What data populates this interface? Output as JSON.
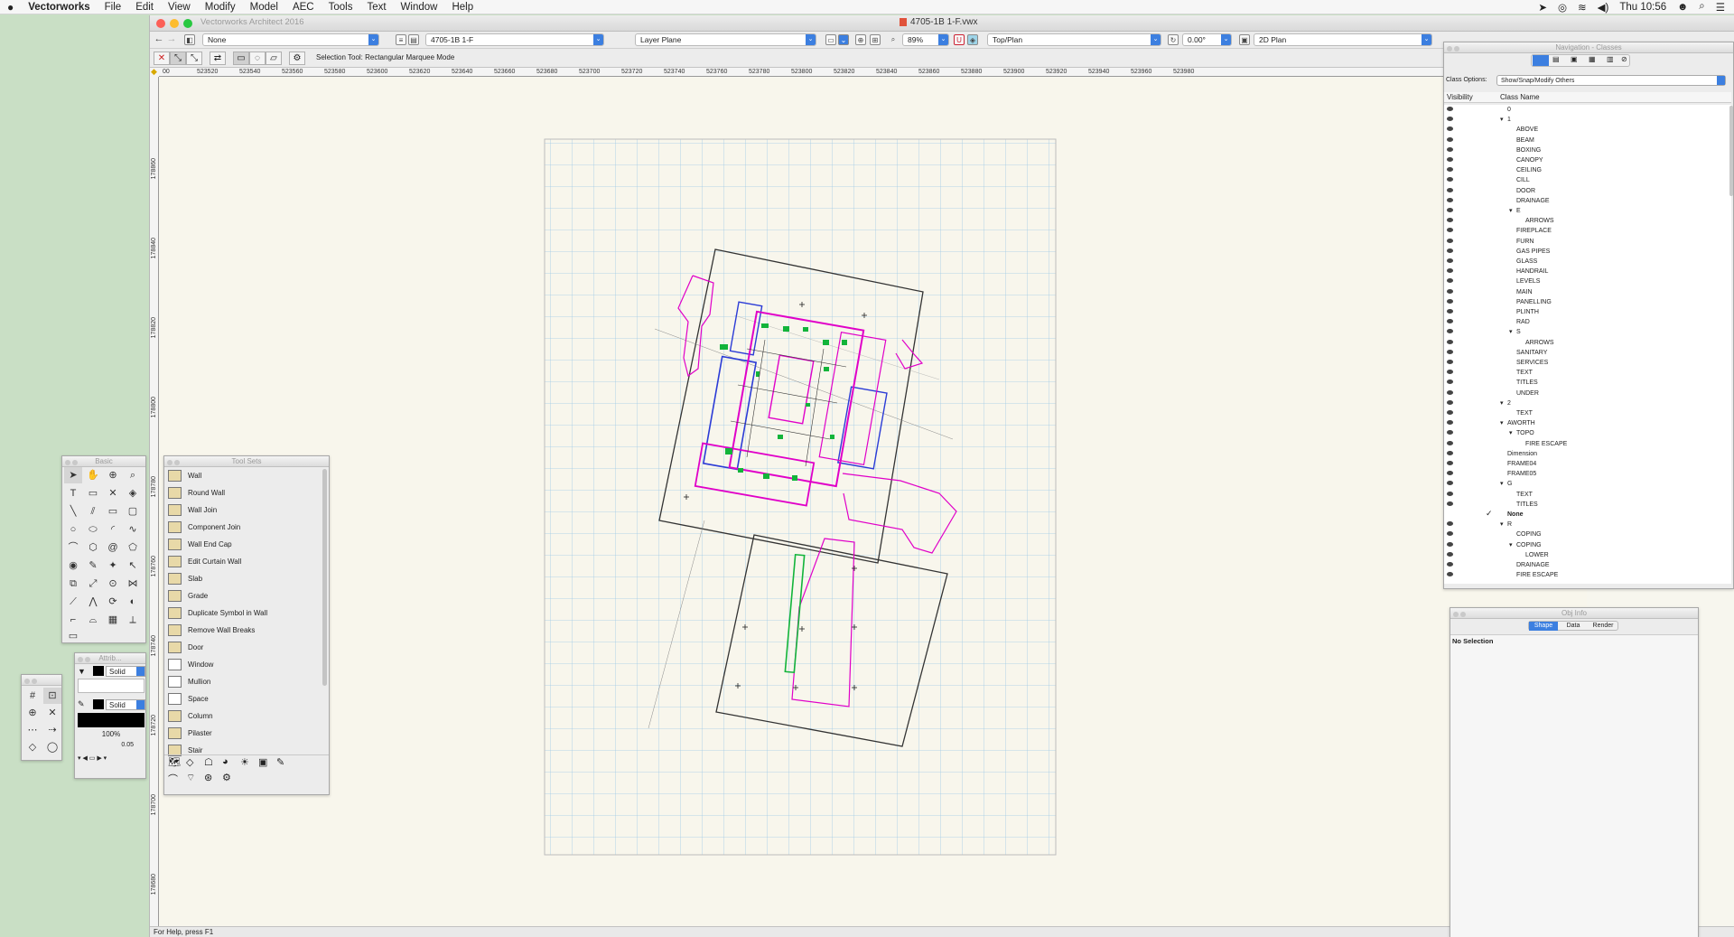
{
  "menubar": {
    "apple": "",
    "app": "Vectorworks",
    "items": [
      "File",
      "Edit",
      "View",
      "Modify",
      "Model",
      "AEC",
      "Tools",
      "Text",
      "Window",
      "Help"
    ],
    "clock": "Thu 10:56"
  },
  "window": {
    "app_title": "Vectorworks Architect 2016",
    "doc_title": "4705-1B 1-F.vwx"
  },
  "toolbar": {
    "class_dropdown": "None",
    "layer_dropdown": "4705-1B 1-F",
    "plane_dropdown": "Layer Plane",
    "zoom": "89%",
    "view": "Top/Plan",
    "rotation": "0.00°",
    "render": "2D Plan",
    "mode_hint": "Selection Tool: Rectangular Marquee Mode"
  },
  "ruler": {
    "top_ticks": [
      "00",
      "523520",
      "523540",
      "523560",
      "523580",
      "523600",
      "523620",
      "523640",
      "523660",
      "523680",
      "523700",
      "523720",
      "523740",
      "523760",
      "523780",
      "523800",
      "523820",
      "523840",
      "523860",
      "523880",
      "523900",
      "523920",
      "523940",
      "523960",
      "523980"
    ],
    "left_ticks": [
      "178860",
      "178840",
      "178820",
      "178800",
      "178780",
      "178760",
      "178740",
      "178720",
      "178700",
      "178680"
    ]
  },
  "basic_palette": {
    "title": "Basic"
  },
  "attrib_palette": {
    "title": "Attrib...",
    "fill": "Solid",
    "pen": "Solid",
    "opacity": "100%",
    "lineweight": "0.05"
  },
  "toolsets_palette": {
    "title": "Tool Sets",
    "items": [
      "Wall",
      "Round Wall",
      "Wall Join",
      "Component Join",
      "Wall End Cap",
      "Edit Curtain Wall",
      "Slab",
      "Grade",
      "Duplicate Symbol in Wall",
      "Remove Wall Breaks",
      "Door",
      "Window",
      "Mullion",
      "Space",
      "Column",
      "Pilaster",
      "Stair"
    ]
  },
  "navigation": {
    "title": "Navigation - Classes",
    "class_options_label": "Class Options:",
    "class_options_value": "Show/Snap/Modify Others",
    "col_visibility": "Visibility",
    "col_class": "Class Name",
    "classes": [
      {
        "name": "0",
        "indent": 0,
        "tri": false
      },
      {
        "name": "1",
        "indent": 0,
        "tri": true
      },
      {
        "name": "ABOVE",
        "indent": 1,
        "tri": false
      },
      {
        "name": "BEAM",
        "indent": 1,
        "tri": false
      },
      {
        "name": "BOXING",
        "indent": 1,
        "tri": false
      },
      {
        "name": "CANOPY",
        "indent": 1,
        "tri": false
      },
      {
        "name": "CEILING",
        "indent": 1,
        "tri": false
      },
      {
        "name": "CILL",
        "indent": 1,
        "tri": false
      },
      {
        "name": "DOOR",
        "indent": 1,
        "tri": false
      },
      {
        "name": "DRAINAGE",
        "indent": 1,
        "tri": false
      },
      {
        "name": "E",
        "indent": 1,
        "tri": true
      },
      {
        "name": "ARROWS",
        "indent": 2,
        "tri": false
      },
      {
        "name": "FIREPLACE",
        "indent": 1,
        "tri": false
      },
      {
        "name": "FURN",
        "indent": 1,
        "tri": false
      },
      {
        "name": "GAS PIPES",
        "indent": 1,
        "tri": false
      },
      {
        "name": "GLASS",
        "indent": 1,
        "tri": false
      },
      {
        "name": "HANDRAIL",
        "indent": 1,
        "tri": false
      },
      {
        "name": "LEVELS",
        "indent": 1,
        "tri": false
      },
      {
        "name": "MAIN",
        "indent": 1,
        "tri": false
      },
      {
        "name": "PANELLING",
        "indent": 1,
        "tri": false
      },
      {
        "name": "PLINTH",
        "indent": 1,
        "tri": false
      },
      {
        "name": "RAD",
        "indent": 1,
        "tri": false
      },
      {
        "name": "S",
        "indent": 1,
        "tri": true
      },
      {
        "name": "ARROWS",
        "indent": 2,
        "tri": false
      },
      {
        "name": "SANITARY",
        "indent": 1,
        "tri": false
      },
      {
        "name": "SERVICES",
        "indent": 1,
        "tri": false
      },
      {
        "name": "TEXT",
        "indent": 1,
        "tri": false
      },
      {
        "name": "TITLES",
        "indent": 1,
        "tri": false
      },
      {
        "name": "UNDER",
        "indent": 1,
        "tri": false
      },
      {
        "name": "2",
        "indent": 0,
        "tri": true
      },
      {
        "name": "TEXT",
        "indent": 1,
        "tri": false
      },
      {
        "name": "AWORTH",
        "indent": 0,
        "tri": true
      },
      {
        "name": "TOPO",
        "indent": 1,
        "tri": true
      },
      {
        "name": "FIRE ESCAPE",
        "indent": 2,
        "tri": false
      },
      {
        "name": "Dimension",
        "indent": 0,
        "tri": false
      },
      {
        "name": "FRAME04",
        "indent": 0,
        "tri": false
      },
      {
        "name": "FRAME05",
        "indent": 0,
        "tri": false
      },
      {
        "name": "G",
        "indent": 0,
        "tri": true
      },
      {
        "name": "TEXT",
        "indent": 1,
        "tri": false
      },
      {
        "name": "TITLES",
        "indent": 1,
        "tri": false
      },
      {
        "name": "None",
        "indent": 0,
        "tri": false,
        "active": true
      },
      {
        "name": "R",
        "indent": 0,
        "tri": true
      },
      {
        "name": "COPING",
        "indent": 1,
        "tri": false
      },
      {
        "name": "COPING",
        "indent": 1,
        "tri": true
      },
      {
        "name": "LOWER",
        "indent": 2,
        "tri": false
      },
      {
        "name": "DRAINAGE",
        "indent": 1,
        "tri": false
      },
      {
        "name": "FIRE ESCAPE",
        "indent": 1,
        "tri": false
      }
    ]
  },
  "objinfo": {
    "title": "Obj Info",
    "tabs": [
      "Shape",
      "Data",
      "Render"
    ],
    "selection": "No Selection"
  },
  "status": {
    "text": "For Help, press F1"
  },
  "colors": {
    "accent": "#3c7fe0",
    "grid": "#9fc9e6",
    "magenta": "#e000c8",
    "blue_plan": "#2b3bd6",
    "green_plan": "#12b43a"
  }
}
